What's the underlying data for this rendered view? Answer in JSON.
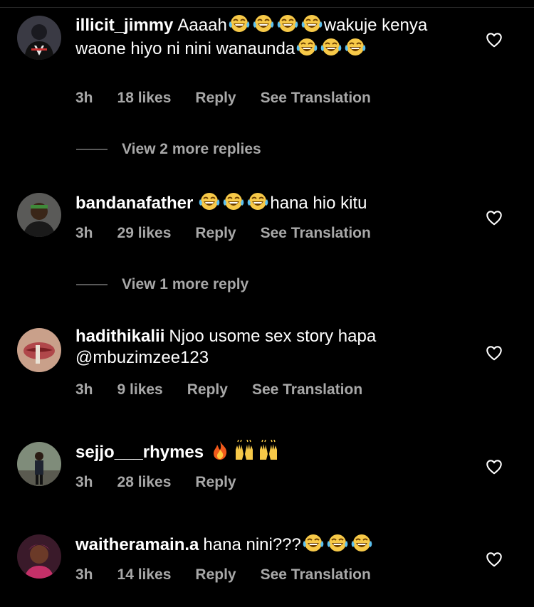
{
  "comments": [
    {
      "username": "illicit_jimmy",
      "text_a": "Aaaah",
      "text_b": "wakuje kenya waone hiyo ni nini wanaunda",
      "time": "3h",
      "likes": "18 likes",
      "reply": "Reply",
      "translation": "See Translation",
      "emoji_a": "face-with-tears-of-joy",
      "emoji_a_count": 4,
      "emoji_b_count": 3
    },
    {
      "username": "bandanafather",
      "text_b": "hana hio kitu",
      "time": "3h",
      "likes": "29 likes",
      "reply": "Reply",
      "translation": "See Translation",
      "emoji_count": 3
    },
    {
      "username": "hadithikalii",
      "text": "Njoo usome sex story hapa @mbuzimzee123",
      "time": "3h",
      "likes": "9 likes",
      "reply": "Reply",
      "translation": "See Translation"
    },
    {
      "username": "sejjo___rhymes",
      "time": "3h",
      "likes": "28 likes",
      "reply": "Reply",
      "emoji": [
        "fire",
        "raising-hands",
        "raising-hands"
      ]
    },
    {
      "username": "waitheramain.a",
      "text": "hana nini???",
      "time": "3h",
      "likes": "14 likes",
      "reply": "Reply",
      "translation": "See Translation",
      "emoji_count": 3
    }
  ],
  "view_replies": [
    "View 2 more replies",
    "View 1 more reply"
  ],
  "colors": {
    "background": "#000000",
    "meta_text": "#a8a8a8",
    "divider": "#262626"
  }
}
